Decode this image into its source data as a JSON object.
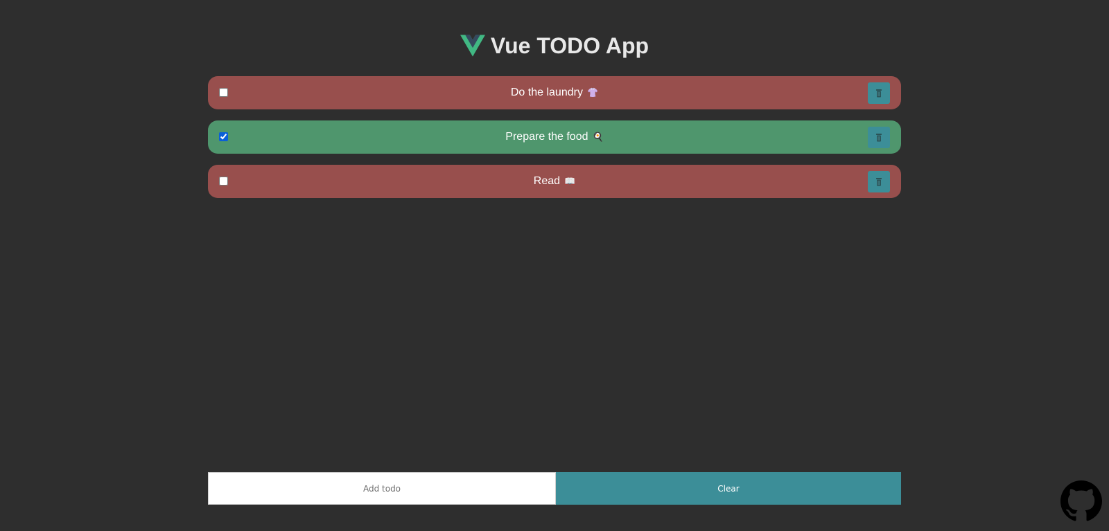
{
  "header": {
    "title": "Vue TODO App",
    "logo_colors": {
      "outer": "#41b883",
      "inner": "#35495e"
    }
  },
  "todos": [
    {
      "text": "Do the laundry",
      "emoji": "👚",
      "emoji_icon": "shirt-icon",
      "checked": false
    },
    {
      "text": "Prepare the food",
      "emoji": "🍳",
      "emoji_icon": "frying-pan-icon",
      "checked": true
    },
    {
      "text": "Read",
      "emoji": "📖",
      "emoji_icon": "book-icon",
      "checked": false
    }
  ],
  "form": {
    "add_placeholder": "Add todo",
    "add_value": "",
    "clear_label": "Clear"
  },
  "colors": {
    "background": "#2e2e2e",
    "pending": "#984f4d",
    "done": "#4f966d",
    "accent": "#3c8e98"
  },
  "footer": {
    "github_icon": "github-icon"
  }
}
